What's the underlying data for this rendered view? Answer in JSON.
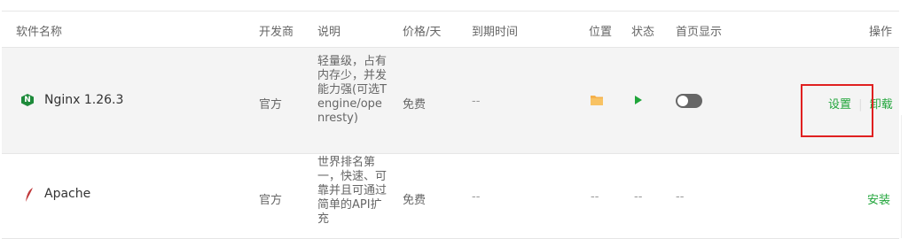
{
  "header": {
    "name": "软件名称",
    "developer": "开发商",
    "description": "说明",
    "price": "价格/天",
    "expire": "到期时间",
    "location": "位置",
    "status": "状态",
    "homepage": "首页显示",
    "actions": "操作"
  },
  "rows": [
    {
      "name": "Nginx 1.26.3",
      "developer": "官方",
      "description": "轻量级，占有内存少，并发能力强(可选Tengine/openresty)",
      "price": "免费",
      "expire": "--",
      "action_settings": "设置",
      "separator": "|",
      "action_uninstall": "卸载",
      "homepage_toggle": "off"
    },
    {
      "name": "Apache",
      "developer": "官方",
      "description": "世界排名第一，快速、可靠并且可通过简单的API扩充",
      "price": "免费",
      "expire": "--",
      "location": "--",
      "status": "--",
      "homepage": "--",
      "action_install": "安装"
    }
  ],
  "colors": {
    "accent": "#20a53a",
    "highlight_box": "#e02020",
    "folder": "#f5b04a"
  }
}
